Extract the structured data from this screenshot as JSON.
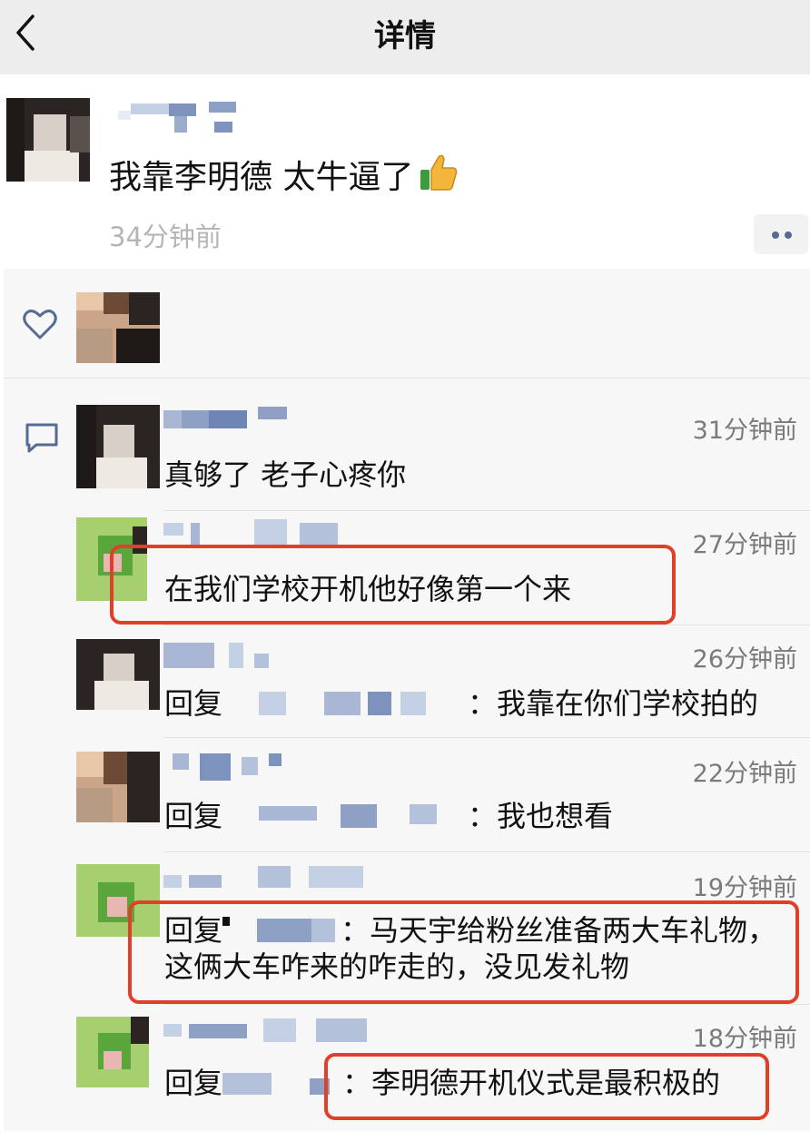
{
  "header": {
    "title": "详情"
  },
  "post": {
    "text": "我靠李明德 太牛逼了",
    "time": "34分钟前"
  },
  "comments": [
    {
      "time": "31分钟前",
      "text": "真够了 老子心疼你"
    },
    {
      "time": "27分钟前",
      "text": "在我们学校开机他好像第一个来"
    },
    {
      "time": "26分钟前",
      "reply_label": "回复",
      "text": "：我靠在你们学校拍的"
    },
    {
      "time": "22分钟前",
      "reply_label": "回复",
      "text": "：我也想看"
    },
    {
      "time": "19分钟前",
      "reply_label": "回复",
      "text": "：马天宇给粉丝准备两大车礼物，",
      "text2": "这俩大车咋来的咋走的，没见发礼物"
    },
    {
      "time": "18分钟前",
      "reply_label": "回复",
      "text": "：李明德开机仪式是最积极的"
    }
  ],
  "colors": {
    "nav_bg": "#ededed",
    "panel_bg": "#f7f7f7",
    "highlight_red": "#e0402a",
    "link_blue": "#556a94",
    "muted_text": "#7a7a7a"
  },
  "icons": [
    "back-arrow-icon",
    "thumbs-up-icon",
    "more-icon",
    "heart-icon",
    "comment-icon"
  ]
}
